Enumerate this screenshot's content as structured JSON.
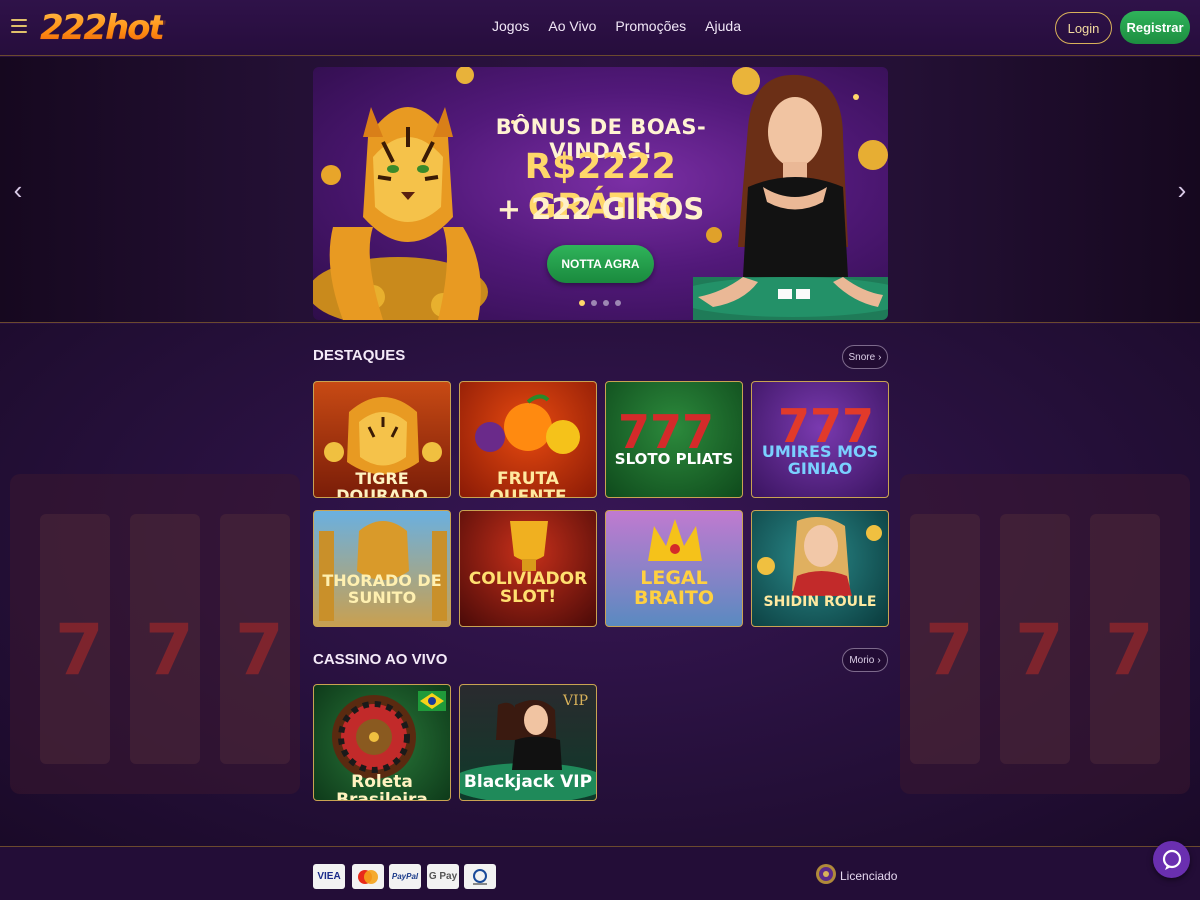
{
  "header": {
    "logo_text": "222hot",
    "nav": [
      "Jogos",
      "Ao Vivo",
      "Promoções",
      "Ajuda"
    ],
    "login_label": "Login",
    "register_label": "Registrar"
  },
  "hero": {
    "title": "BÔNUS DE BOAS-VINDAS!",
    "amount": "R$2222 GRÁTIS",
    "spins": "+ 222 GIROS",
    "cta": "NOTTA AGRA",
    "slides": 4,
    "active_slide": 1
  },
  "featured": {
    "title": "DESTAQUES",
    "more": "Snore",
    "games": [
      {
        "label": "TIGRE DOURADO"
      },
      {
        "label": "FRUTA QUENTE"
      },
      {
        "label": "SLOTO PLIATS"
      },
      {
        "label": "UMIRES MOS GINIAO"
      },
      {
        "label": "THORADO DE SUNITO"
      },
      {
        "label": "COLIVIADOR SLOT!"
      },
      {
        "label": "LEGAL BRAITO"
      },
      {
        "label": "SHIDIN ROULE"
      }
    ]
  },
  "live": {
    "title": "CASSINO AO VIVO",
    "more": "Morio",
    "games": [
      {
        "label": "Roleta Brasileira"
      },
      {
        "label": "Blackjack VIP",
        "badge": "VIP"
      }
    ]
  },
  "footer": {
    "payments": [
      "VIEA",
      "mastercard",
      "PayPal",
      "G Pay",
      "sepa"
    ],
    "license": "Licenciado"
  },
  "colors": {
    "accent_gold": "#d9b25a",
    "register_green": "#2fb35a",
    "bg_purple": "#2a1040"
  }
}
